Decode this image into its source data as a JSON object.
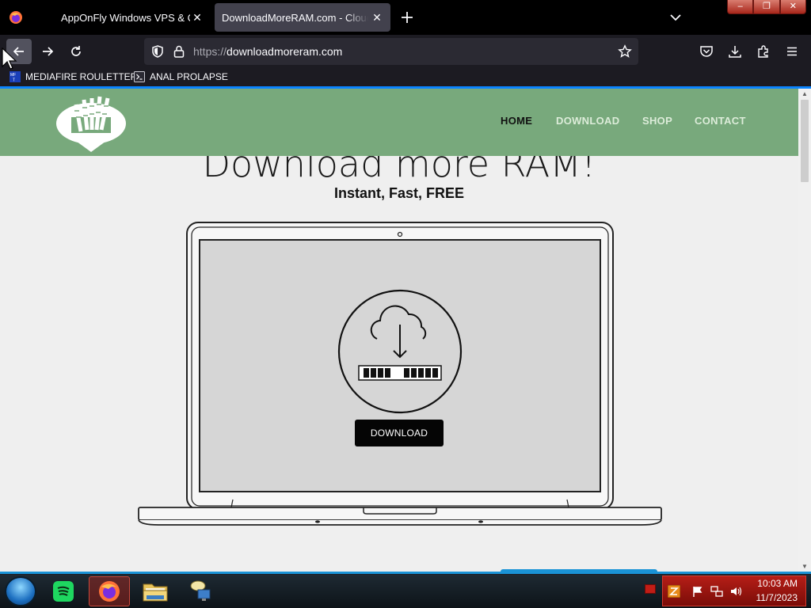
{
  "browser": {
    "tabs": [
      {
        "title": "AppOnFly Windows VPS & Clo"
      },
      {
        "title": "DownloadMoreRAM.com - CloudR"
      }
    ],
    "url": {
      "protocol": "https://",
      "host": "downloadmoreram.com"
    },
    "bookmarks": [
      {
        "label": "MEDIAFIRE ROULETTER"
      },
      {
        "label": "ANAL PROLAPSE"
      }
    ]
  },
  "page": {
    "nav": [
      {
        "label": "HOME",
        "active": true
      },
      {
        "label": "DOWNLOAD"
      },
      {
        "label": "SHOP"
      },
      {
        "label": "CONTACT"
      }
    ],
    "headline": "Download more RAM!",
    "subheadline": "Instant, Fast, FREE",
    "download_button": "DOWNLOAD"
  },
  "taskbar": {
    "clock_time": "10:03 AM",
    "clock_date": "11/7/2023"
  },
  "colors": {
    "site_header": "#78a97c",
    "accent": "#0a84ff",
    "tray": "#b51e17"
  }
}
